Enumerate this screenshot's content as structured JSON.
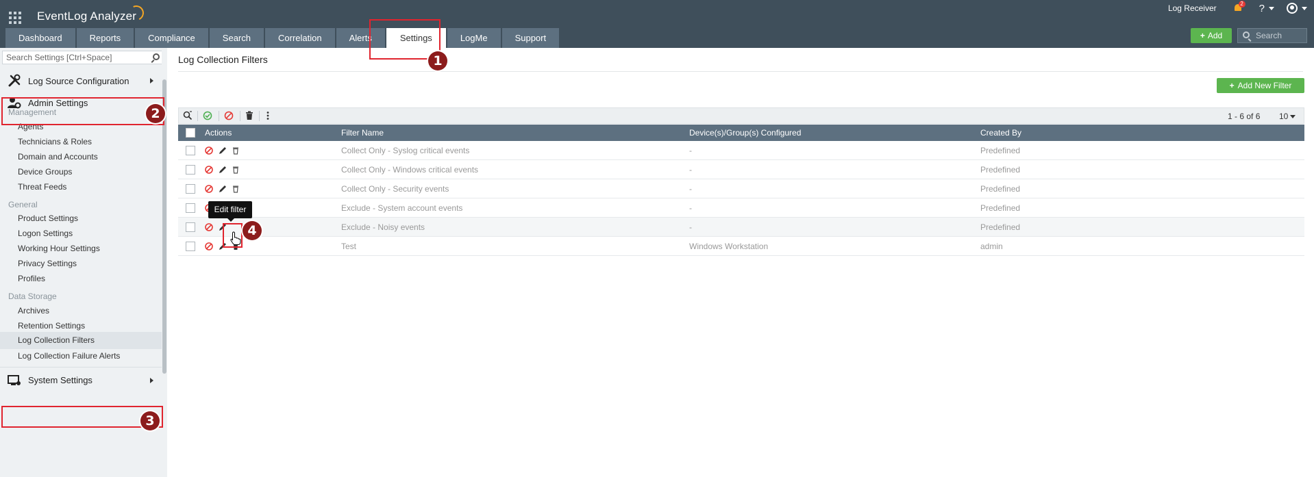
{
  "app": {
    "title": "EventLog Analyzer",
    "log_receiver": "Log Receiver",
    "notification_count": "2",
    "help_label": "?"
  },
  "nav": {
    "tabs": [
      {
        "label": "Dashboard"
      },
      {
        "label": "Reports"
      },
      {
        "label": "Compliance"
      },
      {
        "label": "Search"
      },
      {
        "label": "Correlation"
      },
      {
        "label": "Alerts"
      },
      {
        "label": "Settings",
        "active": true
      },
      {
        "label": "LogMe"
      },
      {
        "label": "Support"
      }
    ],
    "add_label": "Add",
    "search_placeholder": "Search"
  },
  "sidebar": {
    "search_placeholder": "Search Settings [Ctrl+Space]",
    "log_source_config": "Log Source Configuration",
    "admin_settings": "Admin Settings",
    "system_settings": "System Settings",
    "groups": [
      {
        "header": "Management",
        "items": [
          "Agents",
          "Technicians & Roles",
          "Domain and Accounts",
          "Device Groups",
          "Threat Feeds"
        ]
      },
      {
        "header": "General",
        "items": [
          "Product Settings",
          "Logon Settings",
          "Working Hour Settings",
          "Privacy Settings",
          "Profiles"
        ]
      },
      {
        "header": "Data Storage",
        "items": [
          "Archives",
          "Retention Settings",
          "Log Collection Filters",
          "Log Collection Failure Alerts"
        ]
      }
    ],
    "active_item": "Log Collection Filters"
  },
  "main": {
    "title": "Log Collection Filters",
    "add_new_filter": "Add New Filter",
    "pager": "1 - 6 of 6",
    "page_size": "10",
    "columns": [
      "Actions",
      "Filter Name",
      "Device(s)/Group(s) Configured",
      "Created By"
    ],
    "rows": [
      {
        "name": "Collect Only - Syslog critical events",
        "devices": "-",
        "created_by": "Predefined"
      },
      {
        "name": "Collect Only - Windows critical events",
        "devices": "-",
        "created_by": "Predefined"
      },
      {
        "name": "Collect Only - Security events",
        "devices": "-",
        "created_by": "Predefined"
      },
      {
        "name": "Exclude - System account events",
        "devices": "-",
        "created_by": "Predefined"
      },
      {
        "name": "Exclude - Noisy events",
        "devices": "-",
        "created_by": "Predefined"
      },
      {
        "name": "Test",
        "devices": "Windows Workstation",
        "created_by": "admin"
      }
    ],
    "tooltip": "Edit filter"
  },
  "annotations": [
    "1",
    "2",
    "3",
    "4"
  ],
  "colors": {
    "topbar": "#3f4f5b",
    "tab": "#5d7080",
    "green_button": "#5cb54f",
    "annotation_red": "#e0242e",
    "marker_red": "#8c1c1c"
  }
}
